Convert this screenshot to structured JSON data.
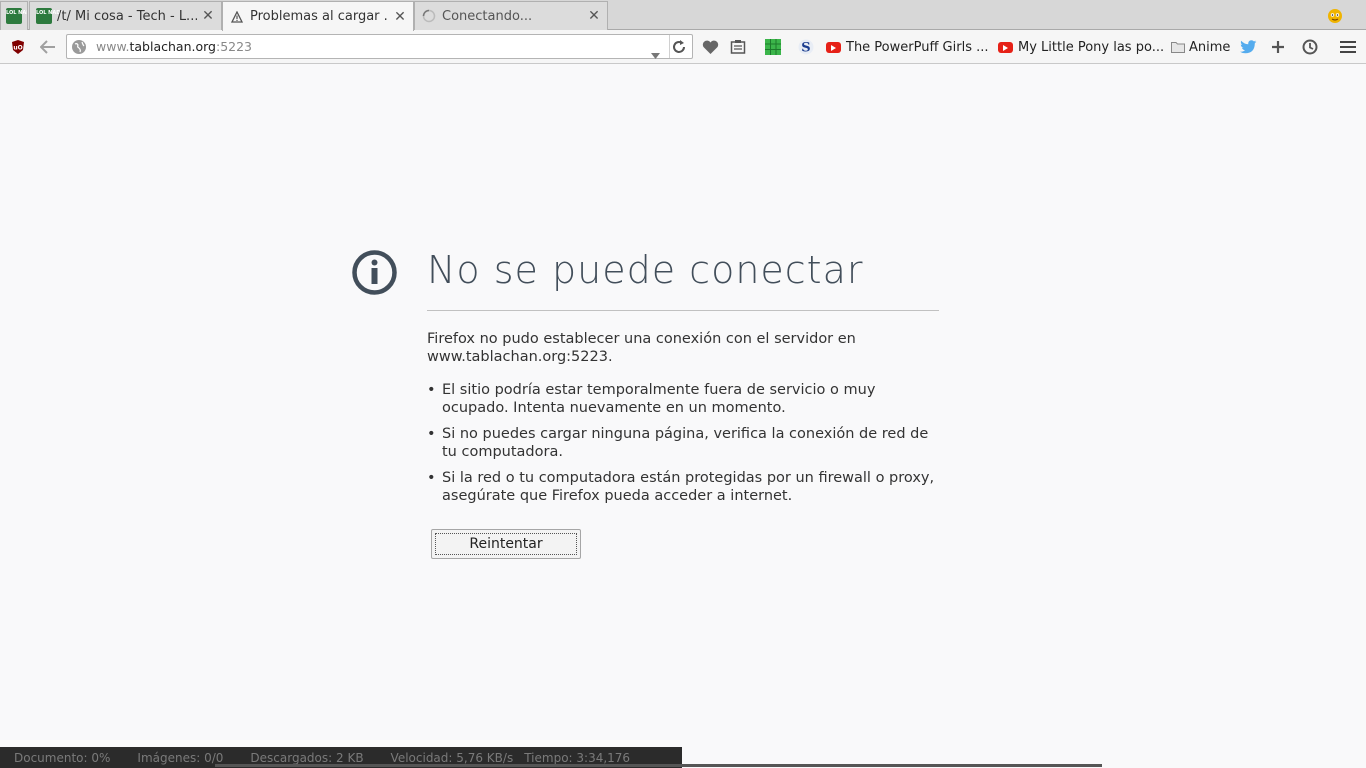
{
  "tabs": [
    {
      "title": "/t/ Mi cosa - Tech - L...",
      "icon": "lolnada-icon",
      "active": false
    },
    {
      "title": "/t/ Mi cosa - Tech - L...",
      "icon": "lolnada-icon",
      "active": false
    },
    {
      "title": "Problemas al cargar ...",
      "icon": "warning-icon",
      "active": true
    },
    {
      "title": "Conectando...",
      "icon": "loading-spinner-icon",
      "active": false
    }
  ],
  "tab_close_glyph": "✕",
  "lolnada_text": "LOL NADA",
  "url": {
    "prefix": "www.",
    "host": "tablachan.org",
    "port": ":5223"
  },
  "bookmarks": [
    {
      "label": "The PowerPuff Girls ...",
      "icon": "youtube-icon"
    },
    {
      "label": "My Little Pony las po...",
      "icon": "youtube-icon"
    },
    {
      "label": "Anime",
      "icon": "folder-icon"
    }
  ],
  "error": {
    "title": "No se puede conectar",
    "description": "Firefox no pudo establecer una conexión con el servidor en www.tablachan.org:5223.",
    "items": [
      "El sitio podría estar temporalmente fuera de servicio o muy ocupado. Intenta nuevamente en un momento.",
      "Si no puedes cargar ninguna página, verifica la conexión de red de tu computadora.",
      "Si la red o tu computadora están protegidas por un firewall o proxy, asegúrate que Firefox pueda acceder a internet."
    ],
    "retry_label": "Reintentar"
  },
  "statusbar": {
    "document": "Documento:  0%",
    "images": "Imágenes: 0/0",
    "downloaded": "Descargados: 2 KB",
    "speed": "Velocidad: 5,76 KB/s",
    "time": "Tiempo: 3:34,176"
  },
  "colors": {
    "error_title": "#424e5a",
    "page_bg": "#f9f9fa",
    "statusbar_bg": "#2b2b2b"
  }
}
